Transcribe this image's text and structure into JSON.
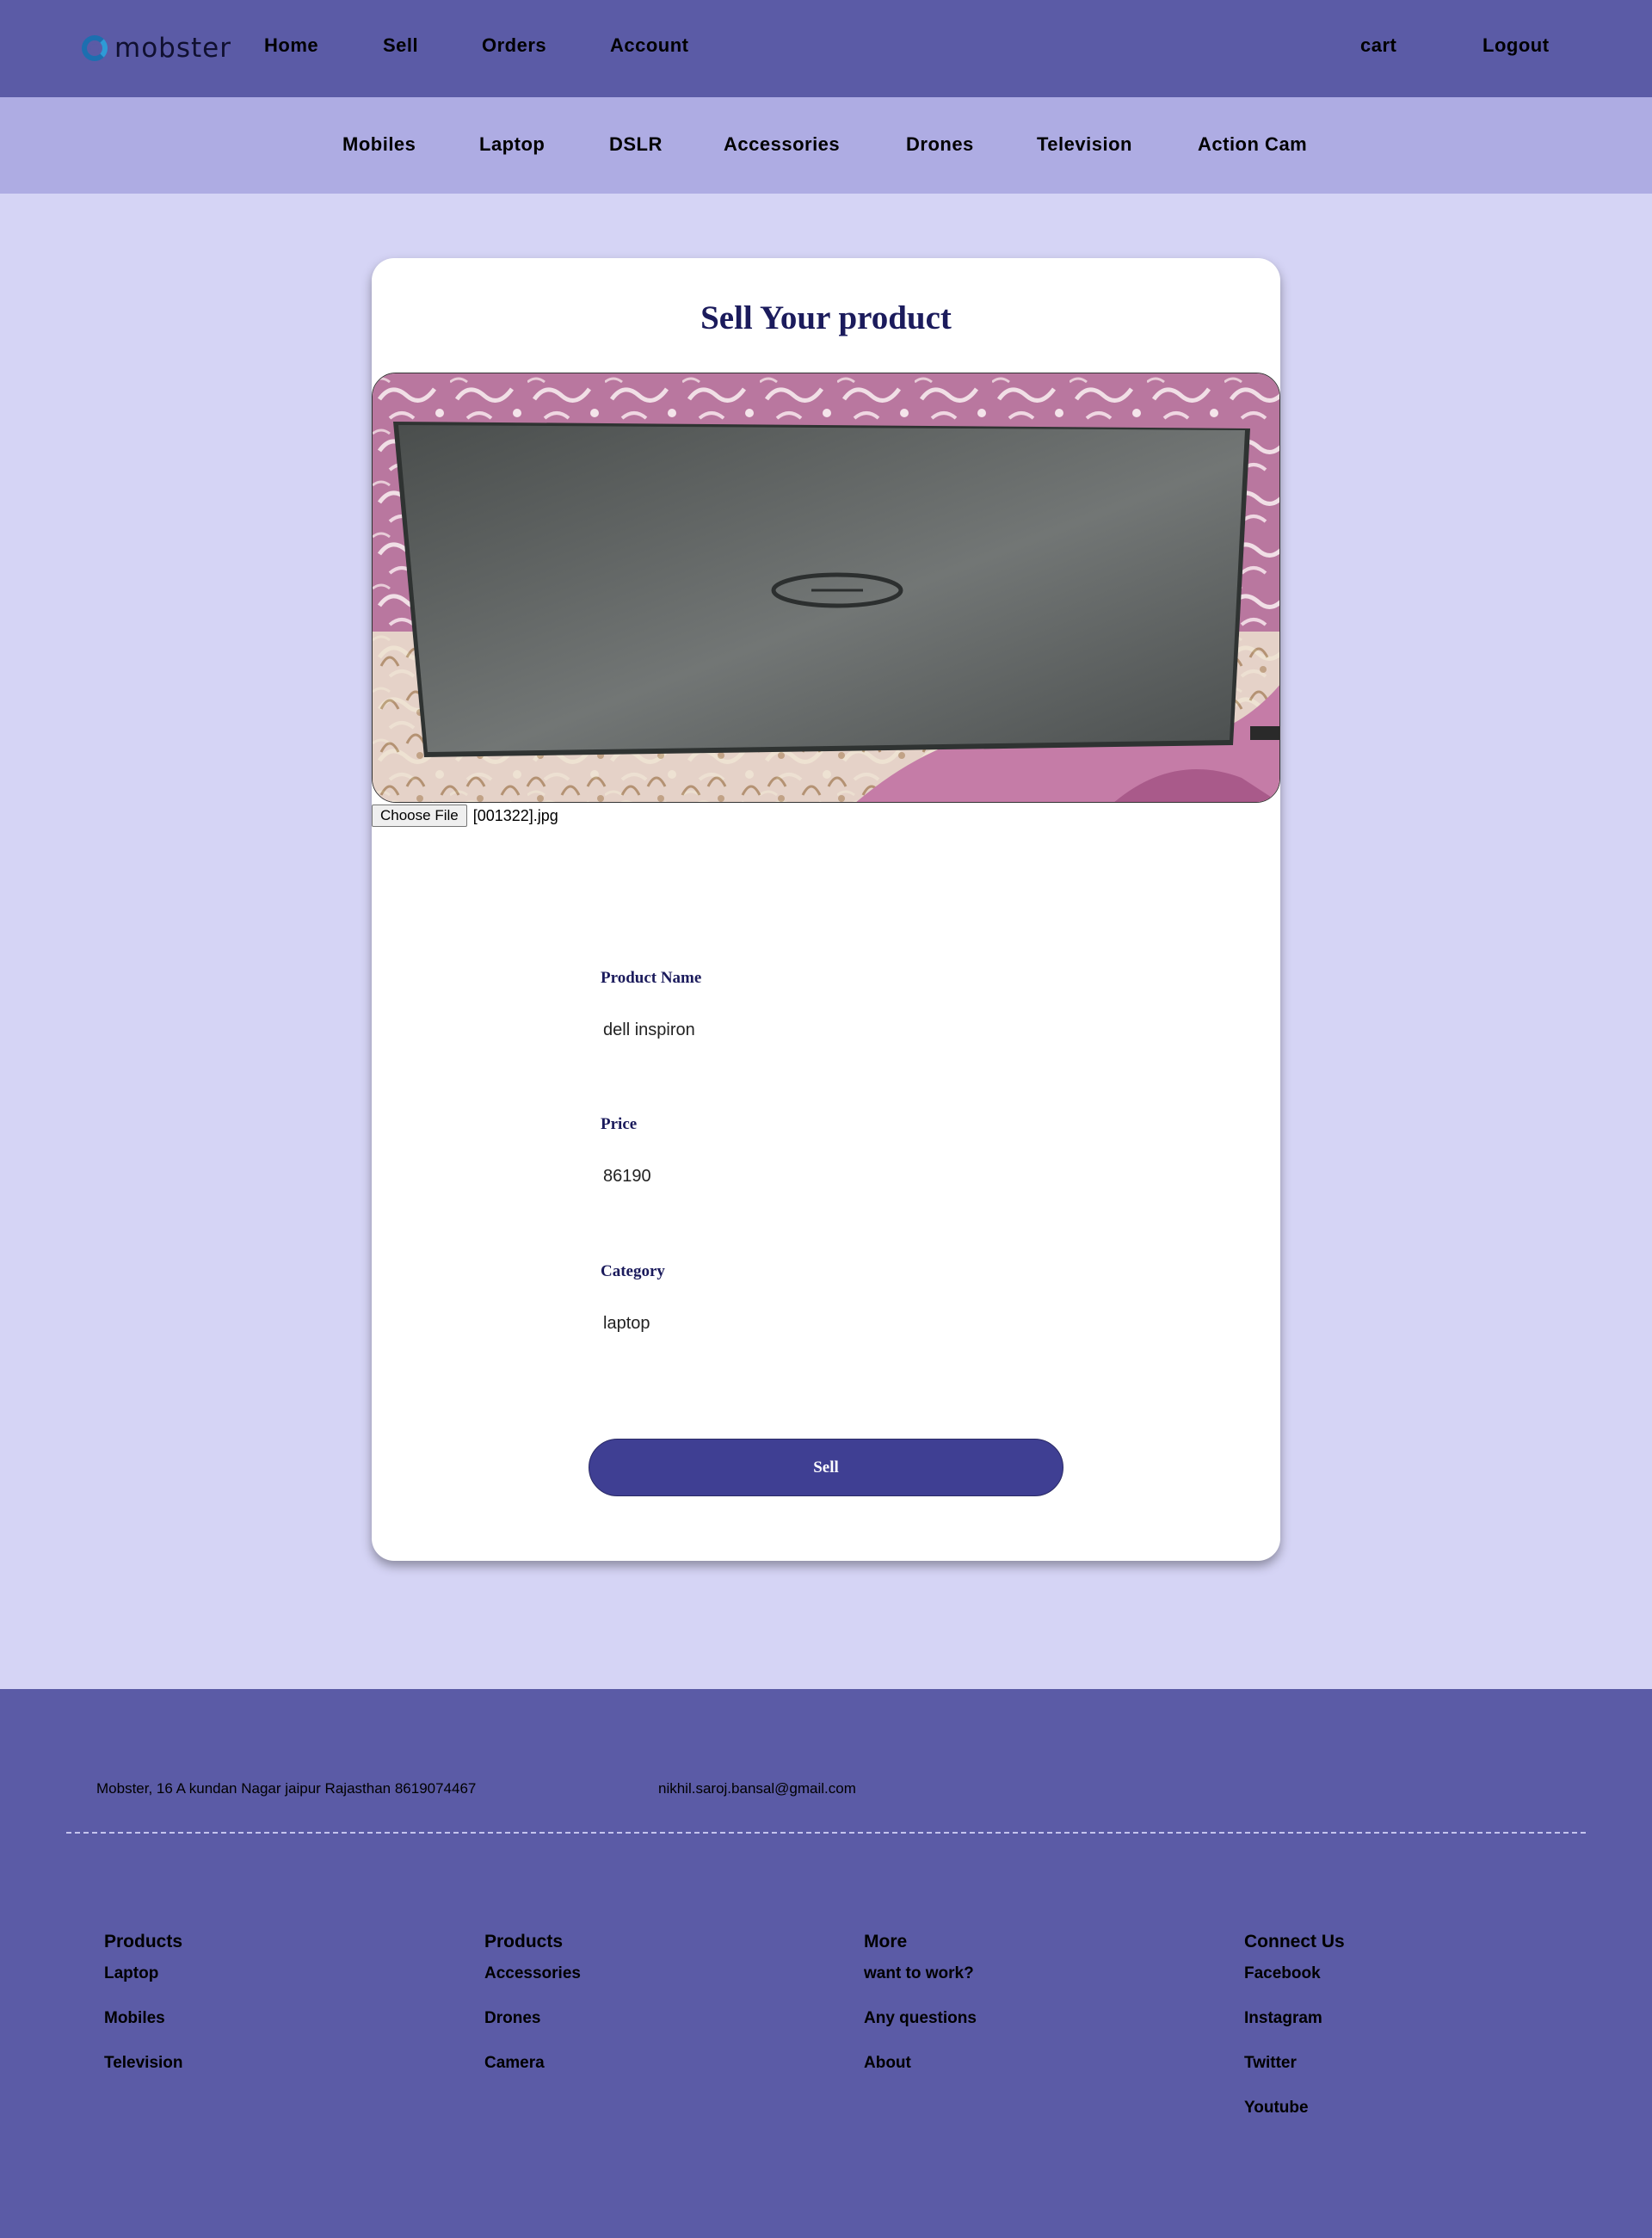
{
  "brand": {
    "name": "mobster",
    "logo_icon": "mobster-logo-icon"
  },
  "nav": {
    "left": [
      "Home",
      "Sell",
      "Orders",
      "Account"
    ],
    "right": [
      "cart",
      "Logout"
    ]
  },
  "categories": [
    "Mobiles",
    "Laptop",
    "DSLR",
    "Accessories",
    "Drones",
    "Television",
    "Action Cam"
  ],
  "form": {
    "title": "Sell Your product",
    "file_button": "Choose File",
    "file_name": "[001322].jpg",
    "fields": [
      {
        "label": "Product Name",
        "value": "dell inspiron"
      },
      {
        "label": "Price",
        "value": "86190"
      },
      {
        "label": "Category",
        "value": "laptop"
      }
    ],
    "submit": "Sell"
  },
  "footer": {
    "address": "Mobster, 16 A kundan Nagar jaipur Rajasthan  8619074467",
    "email": "nikhil.saroj.bansal@gmail.com",
    "columns": [
      {
        "title": "Products",
        "items": [
          "Laptop",
          "Mobiles",
          "Television"
        ]
      },
      {
        "title": "Products",
        "items": [
          "Accessories",
          "Drones",
          "Camera"
        ]
      },
      {
        "title": "More",
        "items": [
          "want to work?",
          "Any questions",
          "About"
        ]
      },
      {
        "title": "Connect Us",
        "items": [
          "Facebook",
          "Instagram",
          "Twitter",
          "Youtube"
        ]
      }
    ]
  },
  "colors": {
    "nav_bg": "#5b5ba6",
    "category_bg": "#aeace3",
    "page_bg": "#d5d4f5",
    "title_color": "#1b1b5c",
    "button_bg": "#3f3f93"
  }
}
